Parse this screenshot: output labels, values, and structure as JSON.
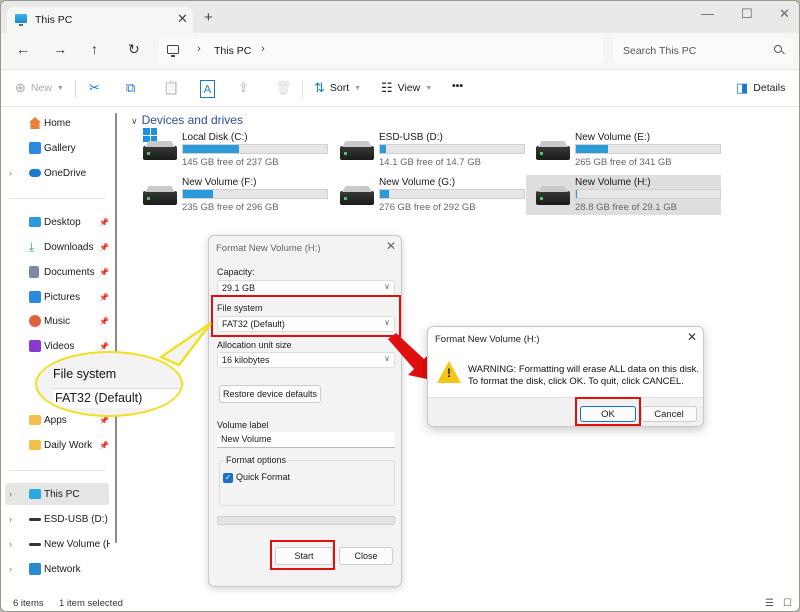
{
  "window": {
    "tab_title": "This PC",
    "controls": {
      "minimize": "—",
      "maximize": "☐",
      "close": "✕"
    }
  },
  "nav": {
    "back": "←",
    "forward": "→",
    "up": "↑",
    "refresh": "↻",
    "breadcrumb": [
      "This PC"
    ],
    "search_placeholder": "Search This PC"
  },
  "toolbar": {
    "new_label": "New",
    "sort_label": "Sort",
    "view_label": "View",
    "more_label": "•••",
    "details_label": "Details",
    "icons": {
      "cut": "✂",
      "copy": "⧉",
      "paste": "📋",
      "rename": "Ａ",
      "share": "⇪",
      "delete": "🗑"
    }
  },
  "sidebar": {
    "quick": [
      {
        "label": "Home",
        "icon": "home-icon",
        "color": "#e8803a"
      },
      {
        "label": "Gallery",
        "icon": "gallery-icon",
        "color": "#2a8ae0"
      },
      {
        "label": "OneDrive",
        "icon": "onedrive-icon",
        "color": "#1a7ad0",
        "expandable": true
      }
    ],
    "pinned": [
      {
        "label": "Desktop",
        "icon": "desktop-icon",
        "color": "#2a9ad8"
      },
      {
        "label": "Downloads",
        "icon": "downloads-icon",
        "color": "#1aa86a"
      },
      {
        "label": "Documents",
        "icon": "documents-icon",
        "color": "#7a8aa0"
      },
      {
        "label": "Pictures",
        "icon": "pictures-icon",
        "color": "#2a8ae0"
      },
      {
        "label": "Music",
        "icon": "music-icon",
        "color": "#e06040"
      },
      {
        "label": "Videos",
        "icon": "videos-icon",
        "color": "#8a3ad0"
      },
      {
        "label": "Apps",
        "icon": "folder-icon",
        "color": "#f2c04a"
      },
      {
        "label": "Daily Work",
        "icon": "folder-icon",
        "color": "#f2c04a"
      }
    ],
    "tree": [
      {
        "label": "This PC",
        "icon": "this-pc-icon",
        "selected": true
      },
      {
        "label": "ESD-USB (D:)",
        "icon": "usb-drive-icon"
      },
      {
        "label": "New Volume (H",
        "icon": "drive-icon"
      },
      {
        "label": "Network",
        "icon": "network-icon"
      }
    ]
  },
  "main": {
    "section_title": "Devices and drives",
    "drives": [
      {
        "name": "Local Disk (C:)",
        "free": "145 GB free of 237 GB",
        "used_fraction": 0.39,
        "system": true
      },
      {
        "name": "ESD-USB (D:)",
        "free": "14.1 GB free of 14.7 GB",
        "used_fraction": 0.04
      },
      {
        "name": "New Volume (E:)",
        "free": "265 GB free of 341 GB",
        "used_fraction": 0.22
      },
      {
        "name": "New Volume (F:)",
        "free": "235 GB free of 296 GB",
        "used_fraction": 0.21
      },
      {
        "name": "New Volume (G:)",
        "free": "276 GB free of 292 GB",
        "used_fraction": 0.06
      },
      {
        "name": "New Volume (H:)",
        "free": "28.8 GB free of 29.1 GB",
        "used_fraction": 0.01,
        "selected": true
      }
    ]
  },
  "status": {
    "items": "6 items",
    "selected": "1 item selected"
  },
  "format_dialog": {
    "title": "Format New Volume (H:)",
    "capacity_label": "Capacity:",
    "capacity_value": "29.1 GB",
    "fs_label": "File system",
    "fs_value": "FAT32 (Default)",
    "alloc_label": "Allocation unit size",
    "alloc_value": "16 kilobytes",
    "restore_label": "Restore device defaults",
    "volume_label_label": "Volume label",
    "volume_label_value": "New Volume",
    "options_label": "Format options",
    "quick_format_label": "Quick Format",
    "quick_format_checked": true,
    "progress": 0,
    "start_label": "Start",
    "close_label": "Close"
  },
  "warning_dialog": {
    "title": "Format New Volume (H:)",
    "line1": "WARNING: Formatting will erase ALL data on this disk.",
    "line2": "To format the disk, click OK. To quit, click CANCEL.",
    "ok_label": "OK",
    "cancel_label": "Cancel"
  },
  "callout": {
    "line1": "File system",
    "line2": "FAT32 (Default)"
  },
  "annotation_colors": {
    "highlight": "#e01010",
    "callout": "#f0e020"
  }
}
